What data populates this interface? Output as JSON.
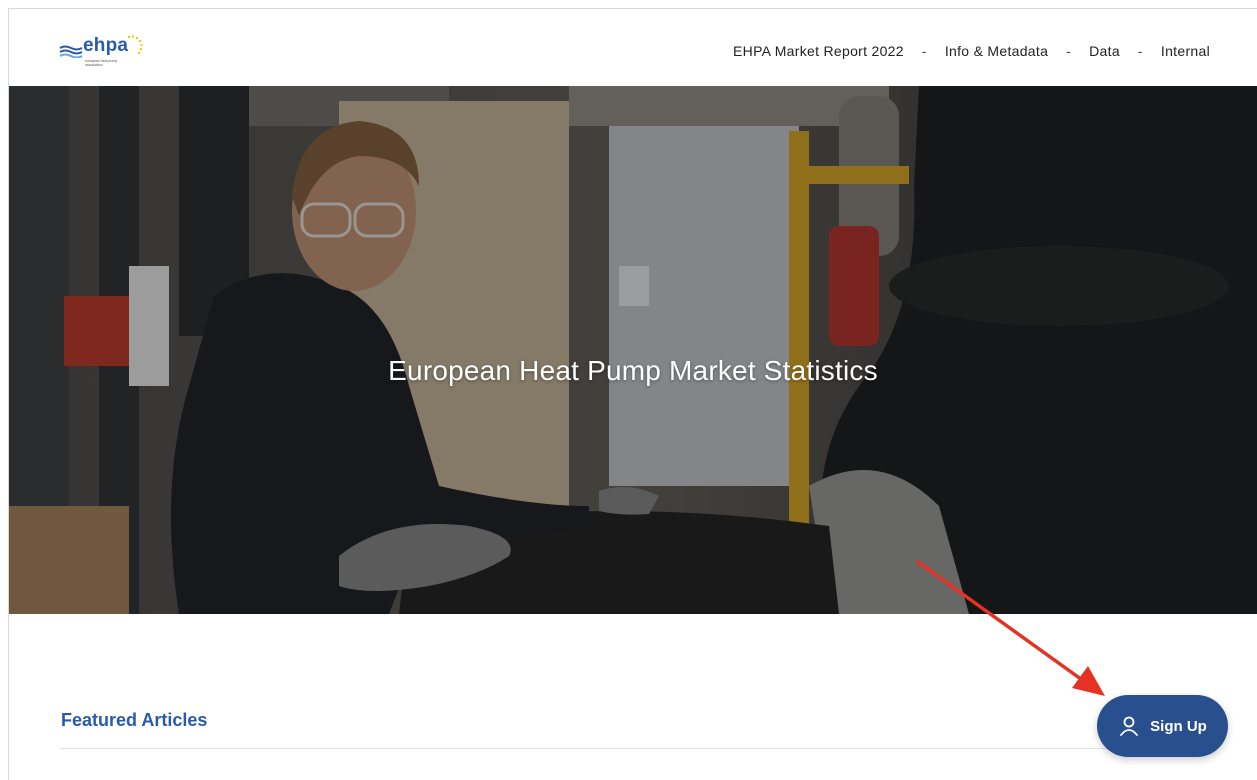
{
  "header": {
    "logo": {
      "text": "ehpa",
      "subtitle": "european heat pump association",
      "icon": "ehpa-logo"
    },
    "nav": [
      {
        "label": "EHPA Market Report 2022"
      },
      {
        "label": "Info & Metadata"
      },
      {
        "label": "Data"
      },
      {
        "label": "Internal"
      }
    ],
    "separator": "-"
  },
  "hero": {
    "title": "European Heat Pump Market Statistics",
    "image": "worker-heat-pump-factory-photo"
  },
  "main": {
    "section_title": "Featured Articles"
  },
  "signup": {
    "label": "Sign Up",
    "icon": "user-icon"
  },
  "annotation": {
    "icon": "red-arrow-icon",
    "color": "#e63222"
  },
  "colors": {
    "brand_blue": "#2b5aa8",
    "button_blue": "#294f8f"
  }
}
